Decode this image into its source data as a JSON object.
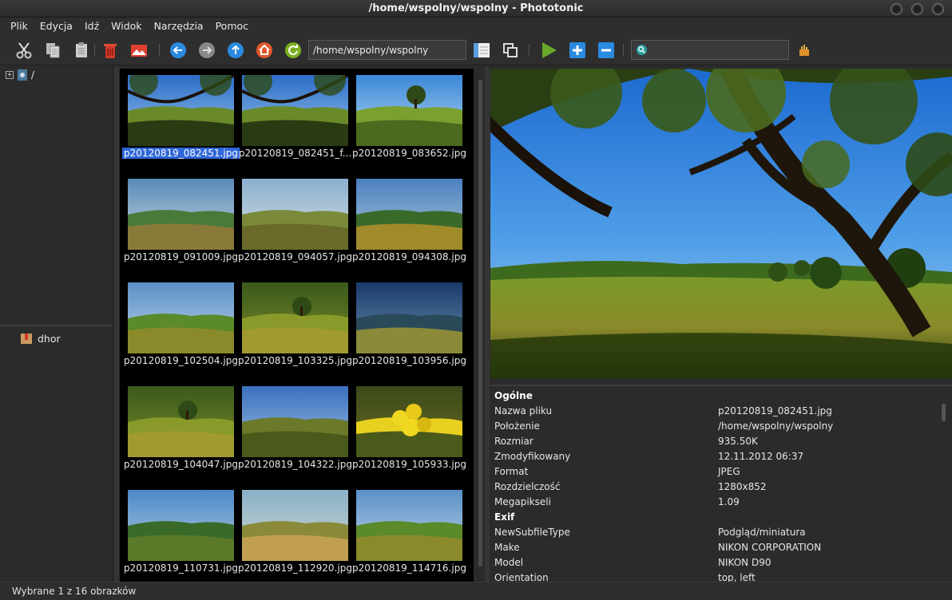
{
  "window": {
    "title": "/home/wspolny/wspolny - Phototonic"
  },
  "menu": [
    "Plik",
    "Edycja",
    "Idź",
    "Widok",
    "Narzędzia",
    "Pomoc"
  ],
  "toolbar": {
    "path": "/home/wspolny/wspolny",
    "search_placeholder": "",
    "icons": [
      "cut-icon",
      "copy-icon",
      "paste-icon",
      "delete-icon",
      "set-wallpaper-icon",
      "back-icon",
      "forward-icon",
      "up-icon",
      "home-icon",
      "refresh-icon",
      "view-details-icon",
      "compare-icon",
      "slideshow-icon",
      "zoom-in-icon",
      "zoom-out-icon",
      "search-icon",
      "filter-icon"
    ]
  },
  "tree": {
    "root_label": "/"
  },
  "bookmarks": [
    {
      "label": "dhor"
    }
  ],
  "thumbnails": [
    {
      "name": "p20120819_082451.jpg",
      "selected": true,
      "scene": "tree-sky"
    },
    {
      "name": "p20120819_082451_f...",
      "selected": false,
      "scene": "tree-sky"
    },
    {
      "name": "p20120819_083652.jpg",
      "selected": false,
      "scene": "meadow-tree"
    },
    {
      "name": "p20120819_091009.jpg",
      "selected": false,
      "scene": "hills"
    },
    {
      "name": "p20120819_094057.jpg",
      "selected": false,
      "scene": "path"
    },
    {
      "name": "p20120819_094308.jpg",
      "selected": false,
      "scene": "hills-gold"
    },
    {
      "name": "p20120819_102504.jpg",
      "selected": false,
      "scene": "hills-green"
    },
    {
      "name": "p20120819_103325.jpg",
      "selected": false,
      "scene": "field-tree"
    },
    {
      "name": "p20120819_103956.jpg",
      "selected": false,
      "scene": "mountains"
    },
    {
      "name": "p20120819_104047.jpg",
      "selected": false,
      "scene": "field-tree"
    },
    {
      "name": "p20120819_104322.jpg",
      "selected": false,
      "scene": "flowers"
    },
    {
      "name": "p20120819_105933.jpg",
      "selected": false,
      "scene": "yellow-flower"
    },
    {
      "name": "p20120819_110731.jpg",
      "selected": false,
      "scene": "valley"
    },
    {
      "name": "p20120819_112920.jpg",
      "selected": false,
      "scene": "grass-gold"
    },
    {
      "name": "p20120819_114716.jpg",
      "selected": false,
      "scene": "hills-green"
    }
  ],
  "info": [
    {
      "key": "Ogólne",
      "value": "",
      "section": true
    },
    {
      "key": "Nazwa pliku",
      "value": "p20120819_082451.jpg"
    },
    {
      "key": "Położenie",
      "value": "/home/wspolny/wspolny"
    },
    {
      "key": "Rozmiar",
      "value": "935.50K"
    },
    {
      "key": "Zmodyfikowany",
      "value": "12.11.2012 06:37"
    },
    {
      "key": "Format",
      "value": "JPEG"
    },
    {
      "key": "Rozdzielczość",
      "value": "1280x852"
    },
    {
      "key": "Megapikseli",
      "value": "1.09"
    },
    {
      "key": "Exif",
      "value": "",
      "section": true
    },
    {
      "key": "NewSubfileType",
      "value": "Podgląd/miniatura"
    },
    {
      "key": "Make",
      "value": "NIKON CORPORATION"
    },
    {
      "key": "Model",
      "value": "NIKON D90"
    },
    {
      "key": "Orientation",
      "value": "top, left"
    }
  ],
  "status": {
    "text": "Wybrane 1 z 16 obrazków"
  },
  "colors": {
    "selection": "#2f67d8",
    "background": "#2b2b2b"
  }
}
